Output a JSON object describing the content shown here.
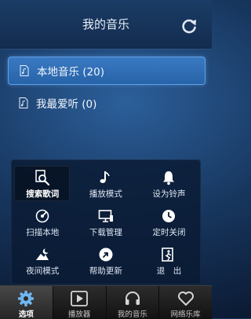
{
  "header": {
    "title": "我的音乐"
  },
  "list": [
    {
      "label": "本地音乐 (20)"
    },
    {
      "label": "我最爱听 (0)"
    }
  ],
  "menu": [
    {
      "label": "搜索歌词",
      "icon": "search-lyrics-icon"
    },
    {
      "label": "播放模式",
      "icon": "play-mode-icon"
    },
    {
      "label": "设为铃声",
      "icon": "bell-icon"
    },
    {
      "label": "扫描本地",
      "icon": "scan-icon"
    },
    {
      "label": "下载管理",
      "icon": "download-manager-icon"
    },
    {
      "label": "定时关闭",
      "icon": "timer-icon"
    },
    {
      "label": "夜间模式",
      "icon": "night-mode-icon"
    },
    {
      "label": "帮助更新",
      "icon": "help-update-icon"
    },
    {
      "label": "退　出",
      "icon": "exit-icon"
    }
  ],
  "tabs": [
    {
      "label": "选项",
      "icon": "gear-icon"
    },
    {
      "label": "播放器",
      "icon": "player-icon"
    },
    {
      "label": "我的音乐",
      "icon": "headphones-icon"
    },
    {
      "label": "网络乐库",
      "icon": "heart-icon"
    }
  ],
  "colors": {
    "accent": "#3a79c2",
    "background": "#17365e",
    "tabbar": "#1e1e1e"
  }
}
